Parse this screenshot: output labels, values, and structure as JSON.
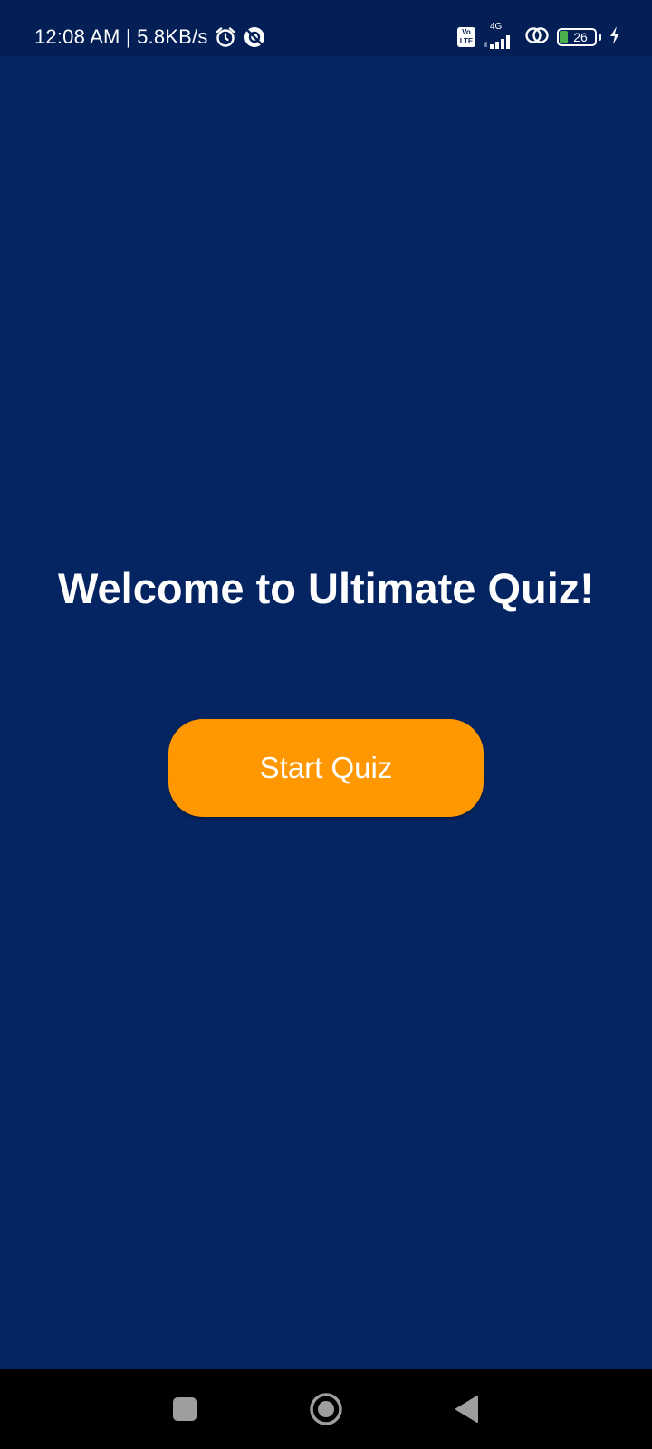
{
  "status_bar": {
    "time_and_speed": "12:08 AM | 5.8KB/s",
    "volte_top": "Vo",
    "volte_bottom": "LTE",
    "network_type": "4G",
    "battery_level": "26",
    "icons": [
      "alarm-icon",
      "data-saver-icon",
      "volte-icon",
      "signal-icon",
      "hotspot-icon",
      "battery-icon",
      "charging-icon"
    ]
  },
  "main": {
    "welcome_text": "Welcome to Ultimate Quiz!",
    "start_button_label": "Start Quiz"
  },
  "nav_bar": {
    "icons": [
      "recents-icon",
      "home-icon",
      "back-icon"
    ]
  },
  "colors": {
    "background": "#052562",
    "status_bar": "#031f55",
    "button": "#ff9800",
    "battery_fill": "#4caf50"
  }
}
